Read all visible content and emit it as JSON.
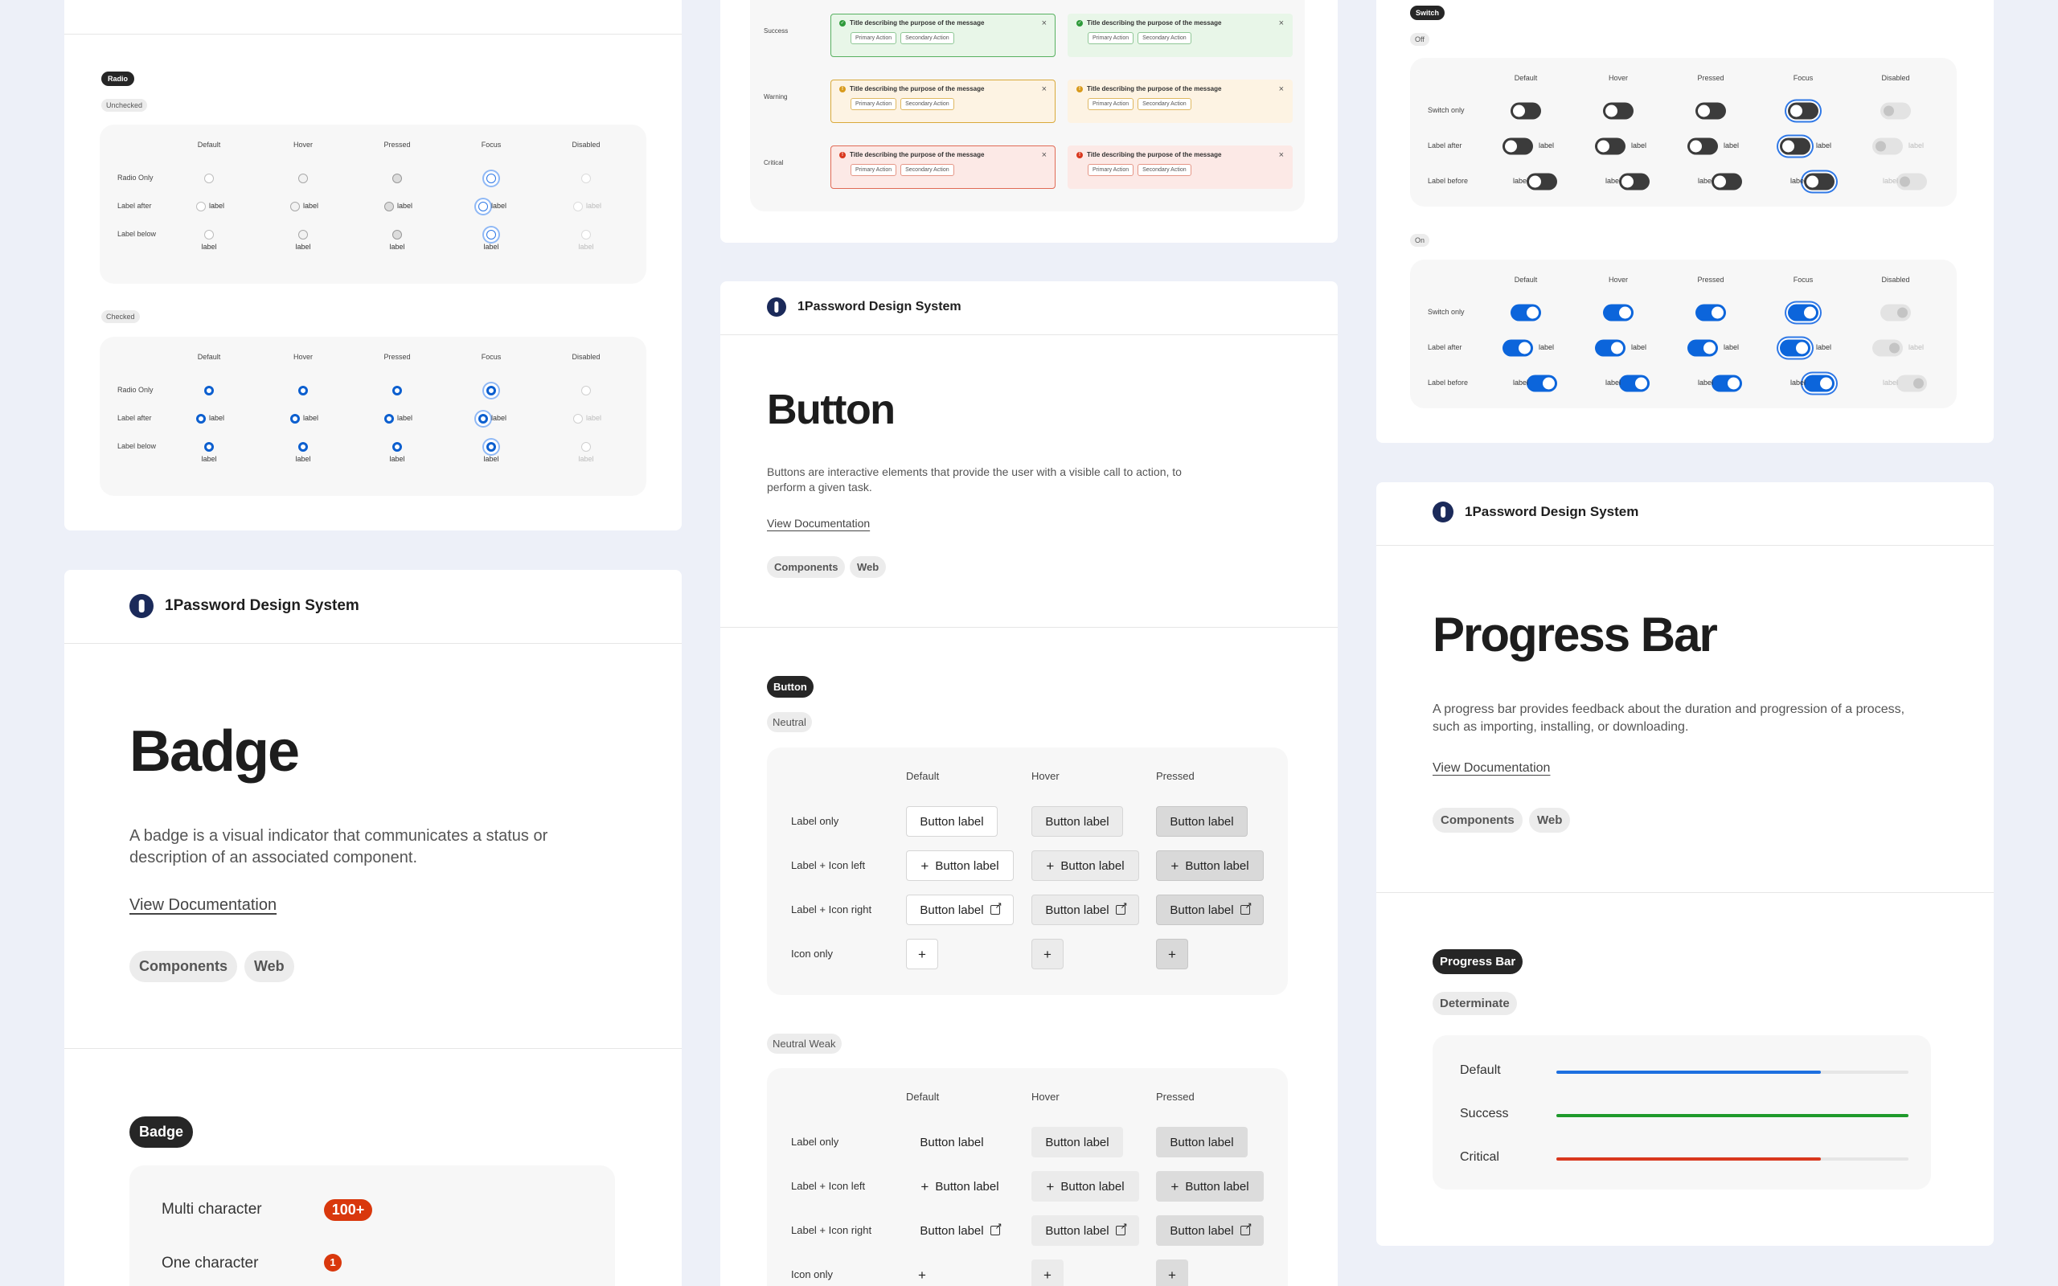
{
  "brand": {
    "name": "1Password Design System"
  },
  "radio": {
    "section_label": "Radio",
    "unchecked_label": "Unchecked",
    "checked_label": "Checked",
    "states": [
      "Default",
      "Hover",
      "Pressed",
      "Focus",
      "Disabled"
    ],
    "rows": [
      "Radio Only",
      "Label after",
      "Label below"
    ],
    "item_label": "label"
  },
  "alerts": {
    "rows": [
      "Success",
      "Warning",
      "Critical"
    ],
    "title": "Title describing the purpose of the message",
    "primary": "Primary Action",
    "secondary": "Secondary Action",
    "close": "×",
    "colors": {
      "success": "#2e9a3a",
      "warning": "#d89a1c",
      "critical": "#d9381e"
    }
  },
  "switch": {
    "section_label": "Switch",
    "off_label": "Off",
    "on_label": "On",
    "states": [
      "Default",
      "Hover",
      "Pressed",
      "Focus",
      "Disabled"
    ],
    "rows": [
      "Switch only",
      "Label after",
      "Label before"
    ],
    "item_label": "label"
  },
  "badge_page": {
    "title": "Badge",
    "description": "A badge is a visual indicator that communicates a status or description of an associated component.",
    "link": "View Documentation",
    "tags": [
      "Components",
      "Web"
    ],
    "section_label": "Badge",
    "rows": [
      {
        "label": "Multi character",
        "value": "100+"
      },
      {
        "label": "One character",
        "value": "1"
      }
    ]
  },
  "button_page": {
    "title": "Button",
    "description": "Buttons are interactive elements that provide the user with a visible call to action, to perform a given task.",
    "link": "View Documentation",
    "tags": [
      "Components",
      "Web"
    ],
    "section_label": "Button",
    "variants": [
      "Neutral",
      "Neutral Weak"
    ],
    "states": [
      "Default",
      "Hover",
      "Pressed"
    ],
    "rows": [
      "Label only",
      "Label + Icon left",
      "Label + Icon right",
      "Icon only"
    ],
    "button_label": "Button label"
  },
  "progress_page": {
    "title": "Progress Bar",
    "description": "A progress bar provides feedback about the duration and progression of a process, such as importing, installing, or downloading.",
    "link": "View Documentation",
    "tags": [
      "Components",
      "Web"
    ],
    "section_label": "Progress Bar",
    "variant": "Determinate",
    "bars": [
      {
        "label": "Default",
        "value": 0.75,
        "color": "#1d6fe0"
      },
      {
        "label": "Success",
        "value": 1.0,
        "color": "#1f9a2c"
      },
      {
        "label": "Critical",
        "value": 0.75,
        "color": "#d9381e"
      }
    ]
  }
}
